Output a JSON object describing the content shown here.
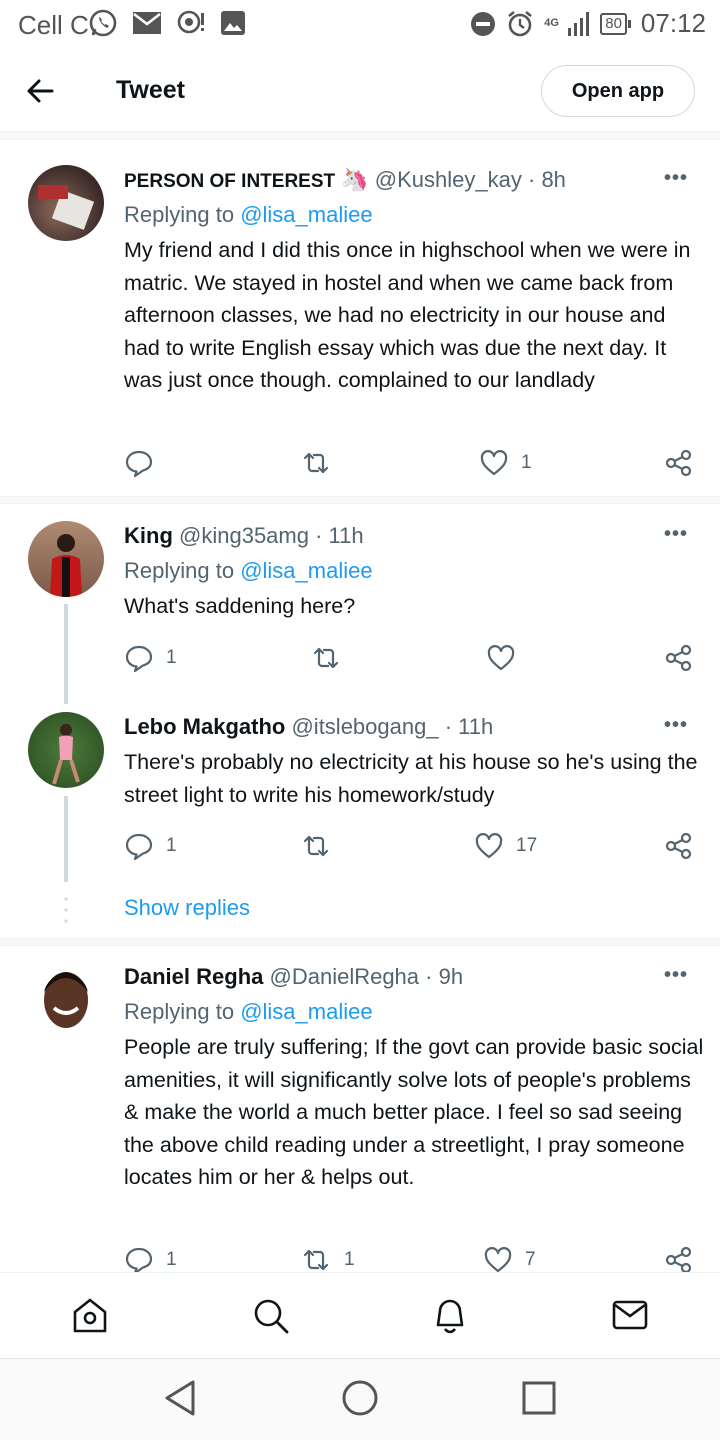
{
  "status_bar": {
    "carrier": "Cell C",
    "battery": "80",
    "time": "07:12",
    "network": "4G"
  },
  "header": {
    "title": "Tweet",
    "open_app": "Open app"
  },
  "tweets": [
    {
      "name": "PERSON OF INTEREST",
      "emoji": "🦄",
      "handle": "@Kushley_kay",
      "time": "· 8h",
      "replying_prefix": "Replying to ",
      "replying_handle": "@lisa_maliee",
      "body": "My friend and I did this once in highschool when we were in matric. We stayed in hostel and when we came back from afternoon classes, we had no electricity in our house and had to write English essay which was due the next day. It was just once though. complained to our landlady",
      "likes": "1"
    },
    {
      "name": "King",
      "handle": "@king35amg",
      "time": "· 11h",
      "replying_prefix": "Replying to ",
      "replying_handle": "@lisa_maliee",
      "body": "What's saddening here?",
      "replies": "1"
    },
    {
      "name": "Lebo Makgatho",
      "handle": "@itslebogang_",
      "time": "· 11h",
      "body": "There's probably no electricity at his house so he's using the street light to write his homework/study",
      "replies": "1",
      "likes": "17"
    },
    {
      "name": "Daniel Regha",
      "handle": "@DanielRegha",
      "time": "· 9h",
      "replying_prefix": "Replying to ",
      "replying_handle": "@lisa_maliee",
      "body": "People are truly suffering; If the govt can provide basic social amenities, it will significantly solve lots of people's problems & make the world a much better place. I feel so sad seeing the above child reading under a streetlight, I pray someone locates him or her & helps out.",
      "replies": "1",
      "retweets": "1",
      "likes": "7"
    }
  ],
  "show_replies": "Show replies",
  "more_glyph": "•••",
  "colors": {
    "accent": "#1d9bf0",
    "secondary": "#536471",
    "text": "#0f1419"
  },
  "icons": [
    "back-arrow-icon",
    "reply-icon",
    "retweet-icon",
    "like-icon",
    "share-icon",
    "home-icon",
    "search-icon",
    "notifications-icon",
    "messages-icon"
  ]
}
